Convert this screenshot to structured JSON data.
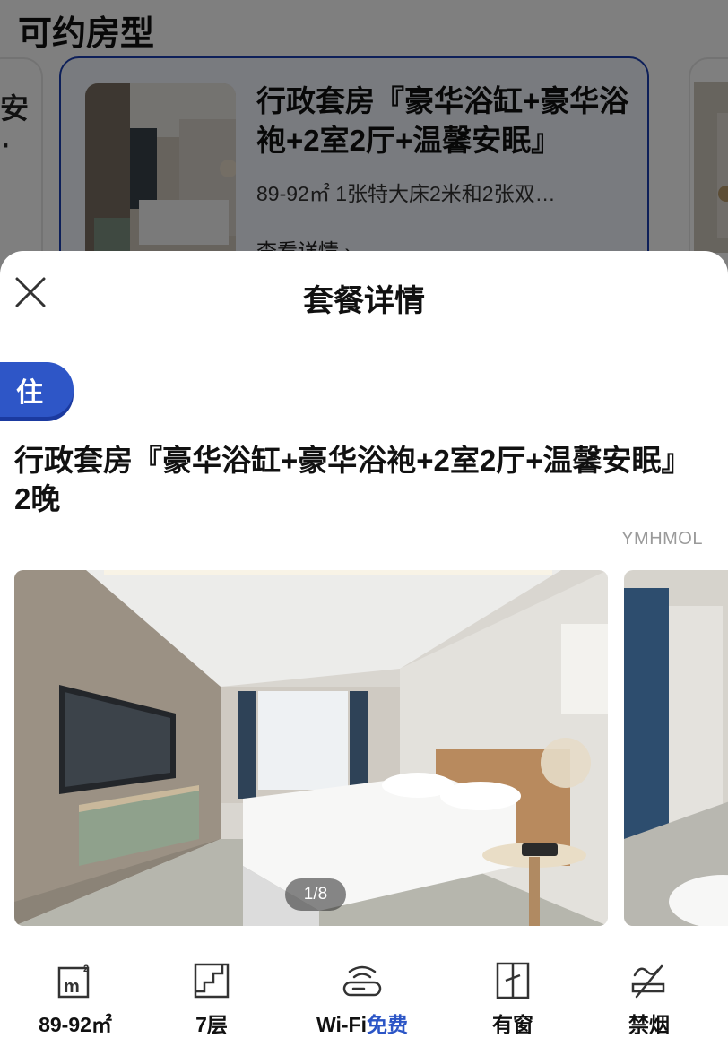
{
  "background": {
    "section_title": "可约房型",
    "left_card_fragments": [
      "安",
      "·"
    ],
    "room_card": {
      "name": "行政套房『豪华浴缸+豪华浴袍+2室2厅+温馨安眠』",
      "meta": "89-92㎡ 1张特大床2米和2张双…",
      "link": "查看详情 ›"
    }
  },
  "sheet": {
    "title": "套餐详情",
    "stay_badge": "住",
    "package_name": "行政套房『豪华浴缸+豪华浴袍+2室2厅+温馨安眠』 2晚",
    "vendor_code": "YMHMOL",
    "photo_counter": "1/8",
    "facilities": [
      {
        "icon": "area-icon",
        "label": "89-92㎡",
        "accent": ""
      },
      {
        "icon": "floor-stairs-icon",
        "label": "7层",
        "accent": ""
      },
      {
        "icon": "wifi-router-icon",
        "label": "Wi-Fi",
        "accent": "免费"
      },
      {
        "icon": "window-icon",
        "label": "有窗",
        "accent": ""
      },
      {
        "icon": "no-smoking-icon",
        "label": "禁烟",
        "accent": ""
      }
    ]
  },
  "colors": {
    "accent_blue": "#2b55c6",
    "card_border": "#1a3fb2",
    "badge_blue": "#2e56c7",
    "overlay": "rgba(0,0,0,0.5)"
  }
}
